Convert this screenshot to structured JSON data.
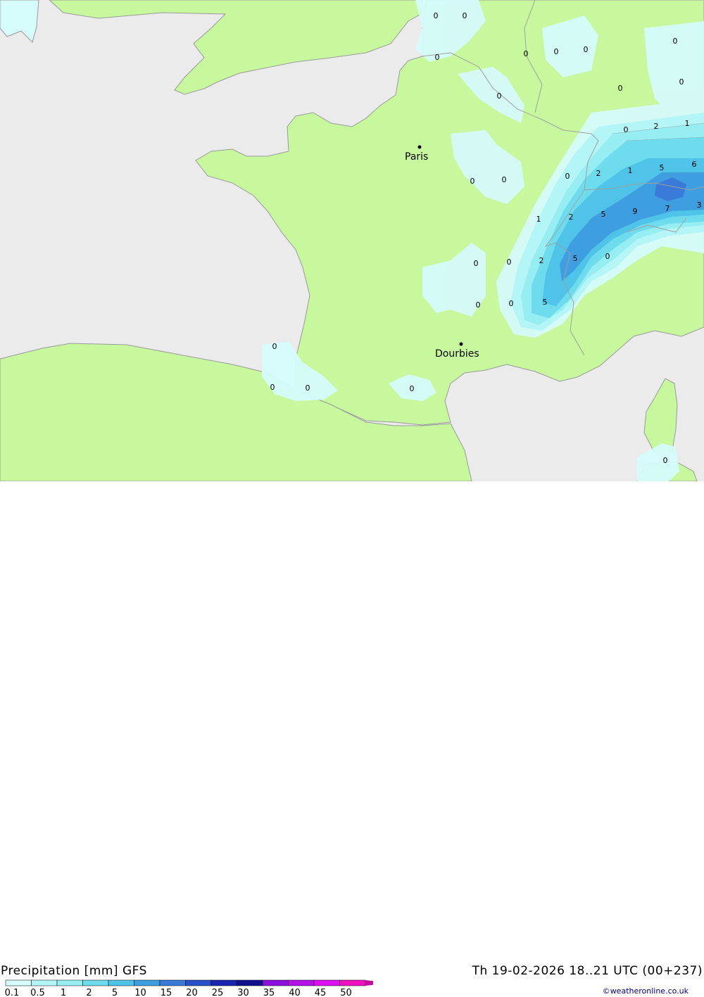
{
  "map": {
    "colors": {
      "sea": "#ebebeb",
      "land": "#c8f89e",
      "border": "#a0a0a0",
      "coast": "#9a9a9a"
    },
    "cities": [
      {
        "name": "Paris"
      },
      {
        "name": "Dourbies"
      }
    ],
    "values": [
      "0",
      "0",
      "0",
      "0",
      "0",
      "0",
      "0",
      "0",
      "0",
      "0",
      "0",
      "2",
      "1",
      "0",
      "2",
      "1",
      "5",
      "6",
      "7",
      "3",
      "1",
      "2",
      "5",
      "9",
      "0",
      "0",
      "2",
      "5",
      "0",
      "0",
      "0",
      "0",
      "5",
      "0",
      "0",
      "0",
      "0",
      "0",
      "0",
      "0",
      "0",
      "0"
    ]
  },
  "title": {
    "left": "Precipitation [mm] GFS",
    "right": "Th 19-02-2026 18..21 UTC (00+237)"
  },
  "credit": "©weatheronline.co.uk",
  "legend": {
    "ticks": [
      "0.1",
      "0.5",
      "1",
      "2",
      "5",
      "10",
      "15",
      "20",
      "25",
      "30",
      "35",
      "40",
      "45",
      "50"
    ],
    "colors": [
      "#d6fbfb",
      "#b4f5f7",
      "#96eef2",
      "#6fdcee",
      "#4fc4e8",
      "#3f9ee0",
      "#3a7ad8",
      "#2a4fc8",
      "#1c25b0",
      "#10108e",
      "#8b10e0",
      "#b410e8",
      "#dc10f0",
      "#f010c0",
      "#c010a0"
    ]
  }
}
